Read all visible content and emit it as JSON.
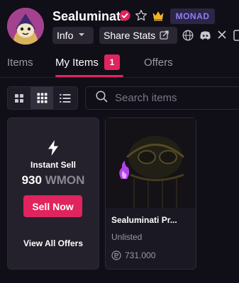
{
  "profile": {
    "username": "Sealuminati",
    "badge": "MONAD",
    "info_label": "Info",
    "share_label": "Share Stats"
  },
  "header_icons": [
    "verified-icon",
    "star-icon",
    "crown-icon",
    "globe-icon",
    "discord-icon",
    "x-icon",
    "more-icon"
  ],
  "tabs": [
    {
      "label": "Items",
      "active": false
    },
    {
      "label": "My Items",
      "active": true,
      "count": "1"
    },
    {
      "label": "Offers",
      "active": false
    }
  ],
  "search": {
    "placeholder": "Search items"
  },
  "instant_sell": {
    "title": "Instant Sell",
    "amount": "930",
    "unit": "WMON",
    "button": "Sell Now",
    "view_all": "View All Offers"
  },
  "nft": {
    "name": "Sealuminati Pr...",
    "status": "Unlisted",
    "price": "731.000"
  },
  "colors": {
    "accent": "#e0245e",
    "background": "#100e17",
    "card": "#24212c",
    "badge_text": "#8d7ff2",
    "badge_bg": "#2b2546"
  }
}
